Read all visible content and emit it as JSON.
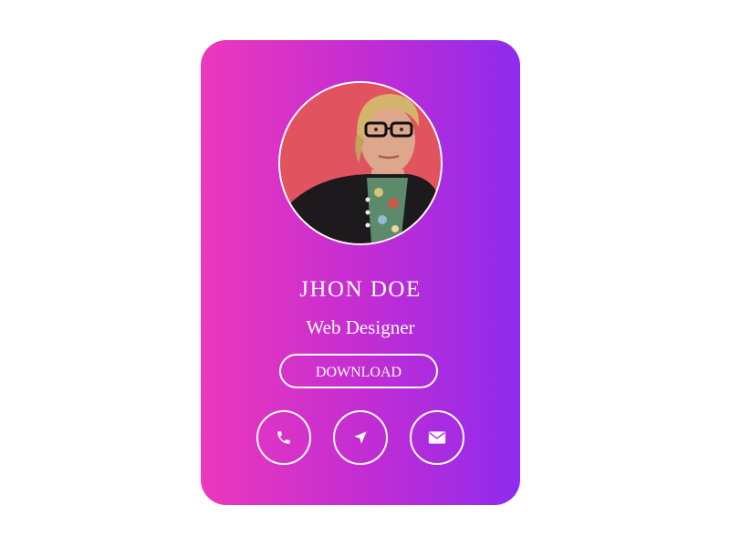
{
  "profile": {
    "name": "JHON DOE",
    "role": "Web Designer",
    "avatar_alt": "profile photo"
  },
  "actions": {
    "download_label": "DOWNLOAD"
  },
  "contact_icons": [
    "phone-icon",
    "location-arrow-icon",
    "envelope-icon"
  ],
  "colors": {
    "gradient_start": "#ec38bc",
    "gradient_end": "#8f2bee",
    "text": "#ffffff"
  }
}
